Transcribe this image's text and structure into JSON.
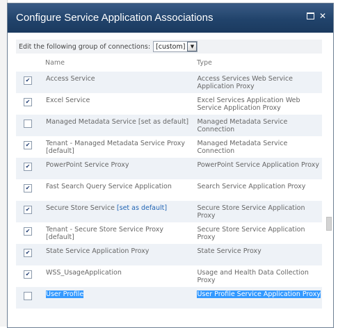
{
  "dialog": {
    "title": "Configure Service Application Associations"
  },
  "group_select": {
    "label": "Edit the following group of connections:",
    "value": "[custom]",
    "arrow_glyph": "▼"
  },
  "columns": {
    "name": "Name",
    "type": "Type"
  },
  "rows": [
    {
      "checked": "✔",
      "name": "Access Service",
      "type": "Access Services Web Service Application Proxy"
    },
    {
      "checked": "✔",
      "name": "Excel Service",
      "type": "Excel Services Application Web Service Application Proxy"
    },
    {
      "checked": "",
      "name": "Managed Metadata Service [set as default]",
      "type": "Managed Metadata Service Connection"
    },
    {
      "checked": "✔",
      "name": "Tenant - Managed Metadata Service Proxy [default]",
      "type": "Managed Metadata Service Connection"
    },
    {
      "checked": "✔",
      "name": "PowerPoint Service Proxy",
      "type": "PowerPoint Service Application Proxy"
    },
    {
      "checked": "✔",
      "name": "Fast Search Query Service Application",
      "type": "Search Service Application Proxy"
    },
    {
      "checked": "✔",
      "name": "Secure Store Service",
      "link": "[set as default]",
      "type": "Secure Store Service Application Proxy"
    },
    {
      "checked": "✔",
      "name": "Tenant - Secure Store Service Proxy [default]",
      "type": "Secure Store Service Application Proxy"
    },
    {
      "checked": "✔",
      "name": "State Service Application Proxy",
      "type": "State Service Proxy"
    },
    {
      "checked": "✔",
      "name": "WSS_UsageApplication",
      "type": "Usage and Health Data Collection Proxy"
    },
    {
      "checked": "",
      "name": "User Profile",
      "type": "User Profile Service Application Proxy"
    }
  ],
  "window_buttons": {
    "maximize": "□",
    "close": "✕"
  }
}
